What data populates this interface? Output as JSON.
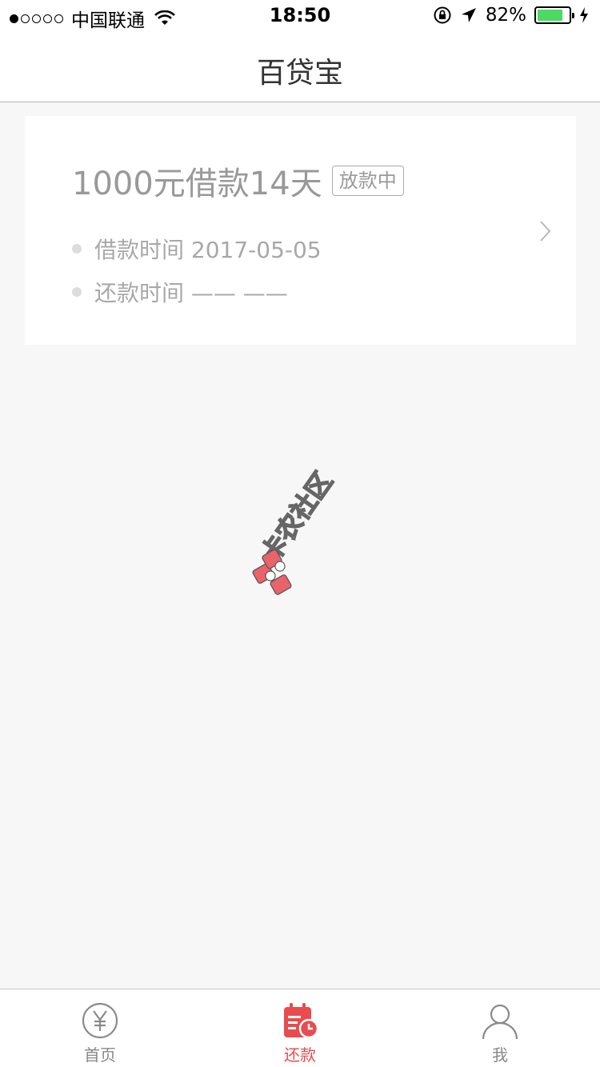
{
  "status_bar": {
    "carrier": "中国联通",
    "time": "18:50",
    "battery_percent": "82%",
    "battery_level": 0.82,
    "signal_bars": 1,
    "signal_total": 5
  },
  "nav": {
    "title": "百贷宝"
  },
  "loan": {
    "title": "1000元借款14天",
    "status": "放款中",
    "borrow_time": "借款时间 2017-05-05",
    "repay_time": "还款时间 —— ——"
  },
  "watermark": {
    "text": "卡农社区"
  },
  "tabs": [
    {
      "label": "首页",
      "icon": "yen-circle-icon",
      "active": false
    },
    {
      "label": "还款",
      "icon": "repay-calendar-icon",
      "active": true
    },
    {
      "label": "我",
      "icon": "user-icon",
      "active": false
    }
  ],
  "colors": {
    "accent": "#e94b4e",
    "battery": "#4cd964",
    "background": "#f7f7f7"
  }
}
